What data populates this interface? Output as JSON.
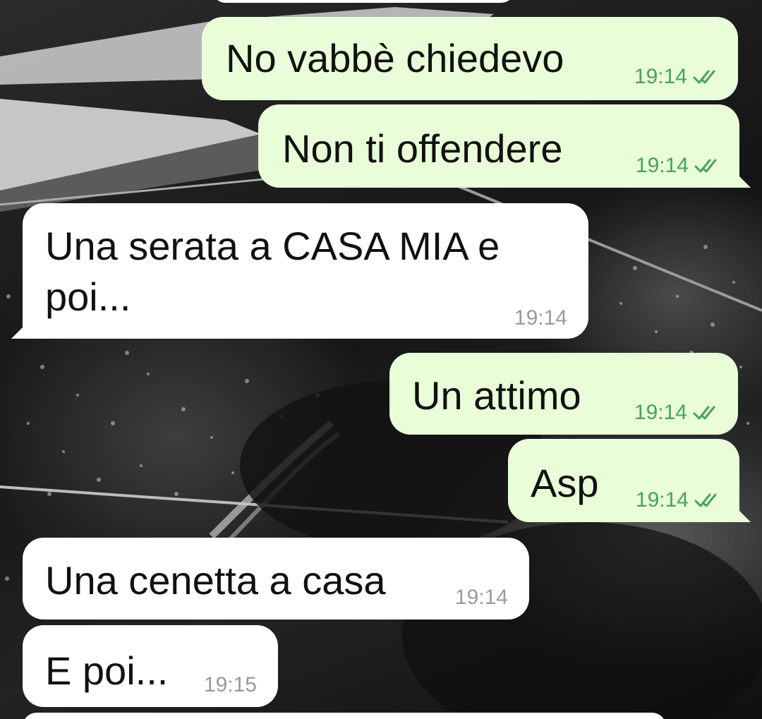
{
  "messages": [
    {
      "text": "No vabbè chiedevo",
      "time": "19:14",
      "direction": "outgoing",
      "status": "read-double-check"
    },
    {
      "text": "Non ti offendere",
      "time": "19:14",
      "direction": "outgoing",
      "status": "read-double-check"
    },
    {
      "text_line1": "Una serata a CASA MIA e",
      "text_line2": "poi...",
      "time": "19:14",
      "direction": "incoming"
    },
    {
      "text": "Un attimo",
      "time": "19:14",
      "direction": "outgoing",
      "status": "read-double-check"
    },
    {
      "text": "Asp",
      "time": "19:14",
      "direction": "outgoing",
      "status": "read-double-check"
    },
    {
      "text": "Una cenetta a casa",
      "time": "19:14",
      "direction": "incoming"
    },
    {
      "text": "E poi...",
      "time": "19:15",
      "direction": "incoming"
    }
  ],
  "colors": {
    "outgoing_bubble": "#e8fdd8",
    "incoming_bubble": "#ffffff",
    "outgoing_time": "#4aa35a",
    "incoming_time": "#9a9a9a",
    "read_tick": "#4aa35a"
  },
  "icons": {
    "read_status": "double-check-icon"
  }
}
